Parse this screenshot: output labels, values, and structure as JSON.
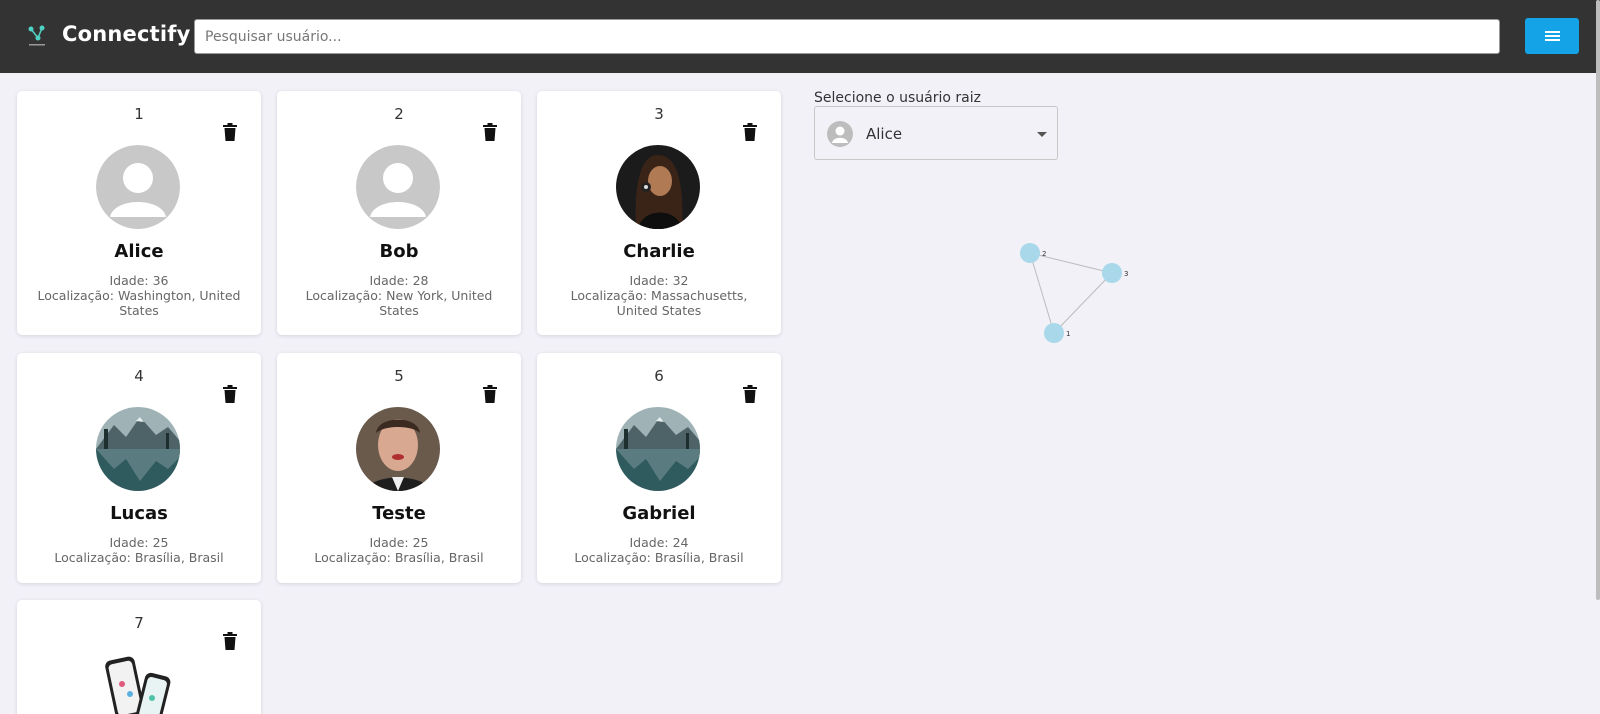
{
  "header": {
    "app_title": "Connectify",
    "logo_icon": "network-logo-icon",
    "search_placeholder": "Pesquisar usuário...",
    "menu_icon": "hamburger-menu-icon",
    "accent_color": "#14a3e6",
    "background_color": "#333333"
  },
  "cards": [
    {
      "id": "1",
      "name": "Alice",
      "age": "Idade: 36",
      "location": "Localização: Washington, United States",
      "avatar": "default-avatar"
    },
    {
      "id": "2",
      "name": "Bob",
      "age": "Idade: 28",
      "location": "Localização: New York, United States",
      "avatar": "default-avatar"
    },
    {
      "id": "3",
      "name": "Charlie",
      "age": "Idade: 32",
      "location": "Localização: Massachusetts, United States",
      "avatar": "photo-woman"
    },
    {
      "id": "4",
      "name": "Lucas",
      "age": "Idade: 25",
      "location": "Localização: Brasília, Brasil",
      "avatar": "photo-mountain-lake"
    },
    {
      "id": "5",
      "name": "Teste",
      "age": "Idade: 25",
      "location": "Localização: Brasília, Brasil",
      "avatar": "photo-man"
    },
    {
      "id": "6",
      "name": "Gabriel",
      "age": "Idade: 24",
      "location": "Localização: Brasília, Brasil",
      "avatar": "photo-mountain-lake"
    },
    {
      "id": "7",
      "name": "",
      "age": "",
      "location": "",
      "avatar": "photo-phones"
    }
  ],
  "root_select": {
    "label": "Selecione o usuário raiz",
    "value": "Alice"
  },
  "graph": {
    "nodes": [
      {
        "id": "1",
        "label": "1"
      },
      {
        "id": "2",
        "label": "2"
      },
      {
        "id": "3",
        "label": "3"
      }
    ],
    "edges": [
      [
        "2",
        "3"
      ],
      [
        "2",
        "1"
      ],
      [
        "3",
        "1"
      ]
    ],
    "node_color": "#a8d8ea",
    "edge_color": "#bbbbbb"
  }
}
